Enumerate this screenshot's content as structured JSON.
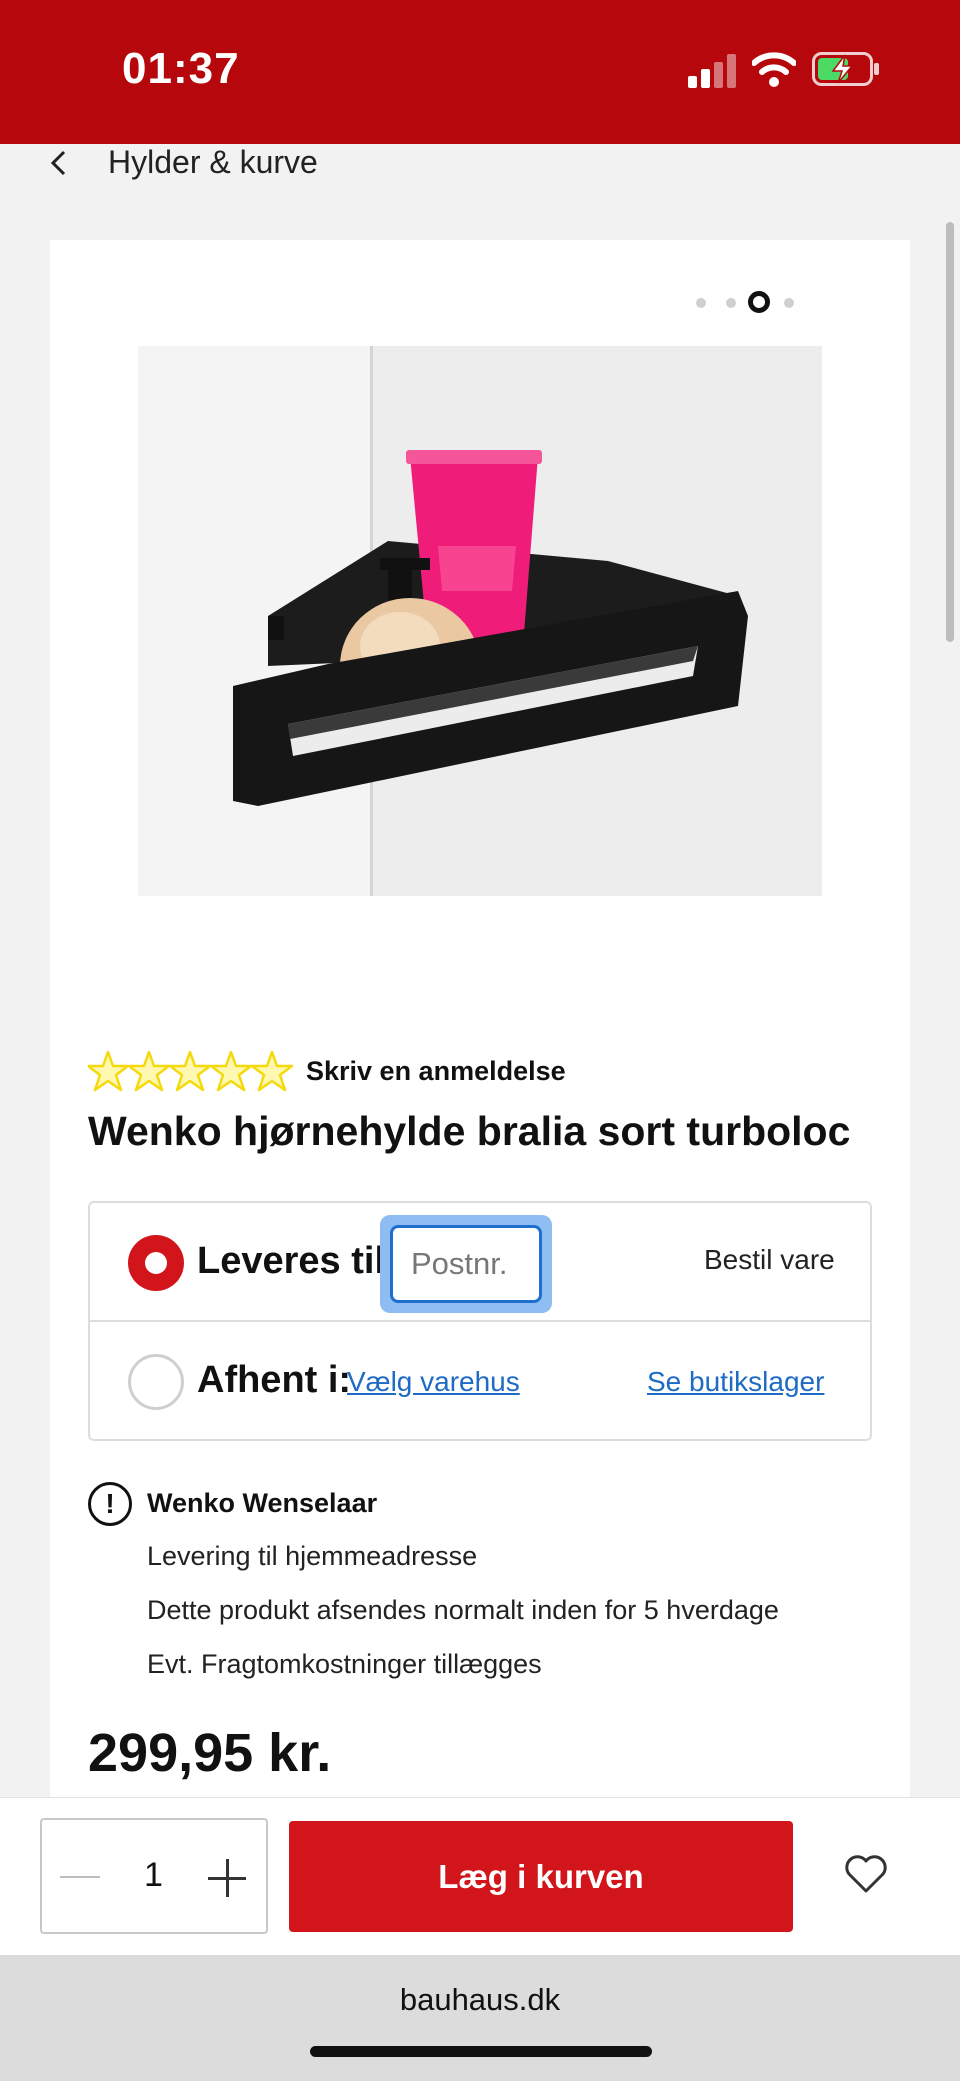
{
  "status_bar": {
    "time": "01:37"
  },
  "breadcrumb": {
    "label": "Hylder & kurve"
  },
  "gallery": {
    "slide_count": 4,
    "active_slide": 3
  },
  "product": {
    "review_link": "Skriv en anmeldelse",
    "rating_stars": 5,
    "title": "Wenko hjørnehylde bralia sort turboloc",
    "price": "299,95 kr."
  },
  "delivery": {
    "deliver_label": "Leveres til:",
    "postnr_placeholder": "Postnr.",
    "order_label": "Bestil vare",
    "pickup_label": "Afhent i:",
    "choose_store_link": "Vælg varehus",
    "store_stock_link": "Se butikslager"
  },
  "info": {
    "title": "Wenko Wenselaar",
    "lines": [
      "Levering til hjemmeadresse",
      "Dette produkt afsendes normalt inden for 5 hverdage",
      "Evt. Fragtomkostninger tillægges"
    ]
  },
  "cart": {
    "quantity": "1",
    "button_label": "Læg i kurven"
  },
  "browser": {
    "url": "bauhaus.dk"
  },
  "colors": {
    "brand_red": "#b5070c",
    "button_red": "#d2141b",
    "link_blue": "#1d6bc4",
    "star_yellow": "#f5d90a"
  }
}
